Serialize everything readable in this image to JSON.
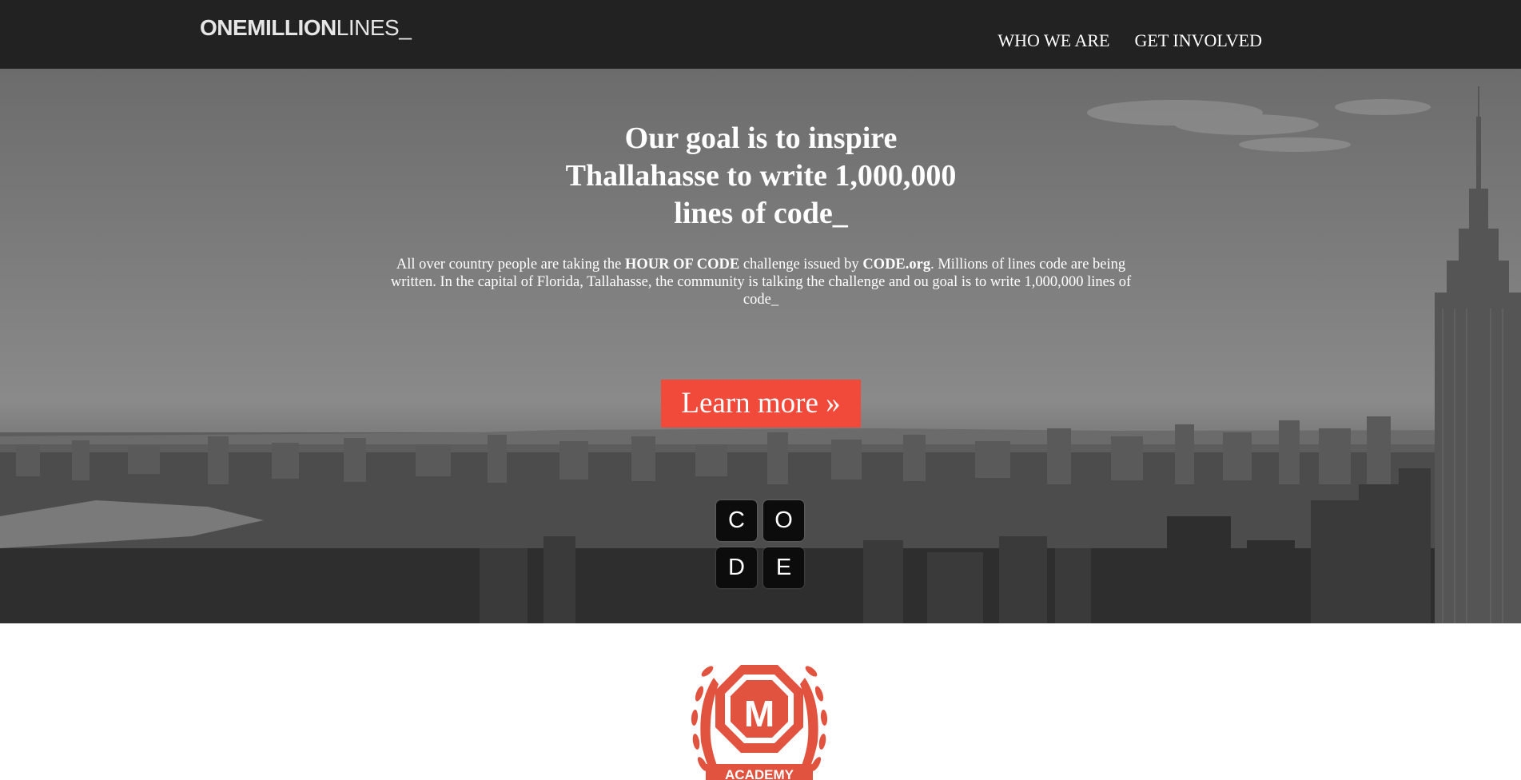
{
  "navbar": {
    "logo_bold": "ONEMILLION",
    "logo_thin": "LINES_",
    "links": [
      "WHO WE ARE",
      "GET INVOLVED"
    ]
  },
  "hero": {
    "title_lines": [
      "Our goal is to inspire",
      "Thallahasse to write 1,000,000",
      "lines of code_"
    ],
    "paragraph": {
      "p1": "All over country people are taking the ",
      "b1": "HOUR OF CODE",
      "p2": " challenge issued by ",
      "b2": "CODE.org",
      "p3": ". Millions of lines code are being written. In the capital of Florida, Tallahasse, the community is talking the challenge and ou goal is to write 1,000,000 lines of code_"
    },
    "button_label": "Learn more »"
  },
  "code_logo": {
    "letters": [
      "C",
      "O",
      "D",
      "E"
    ]
  },
  "badge": {
    "letter": "M",
    "banner": "ACADEMY"
  },
  "colors": {
    "navbar_bg": "#222222",
    "accent": "#f24a3a",
    "badge_red": "#e2533f"
  }
}
